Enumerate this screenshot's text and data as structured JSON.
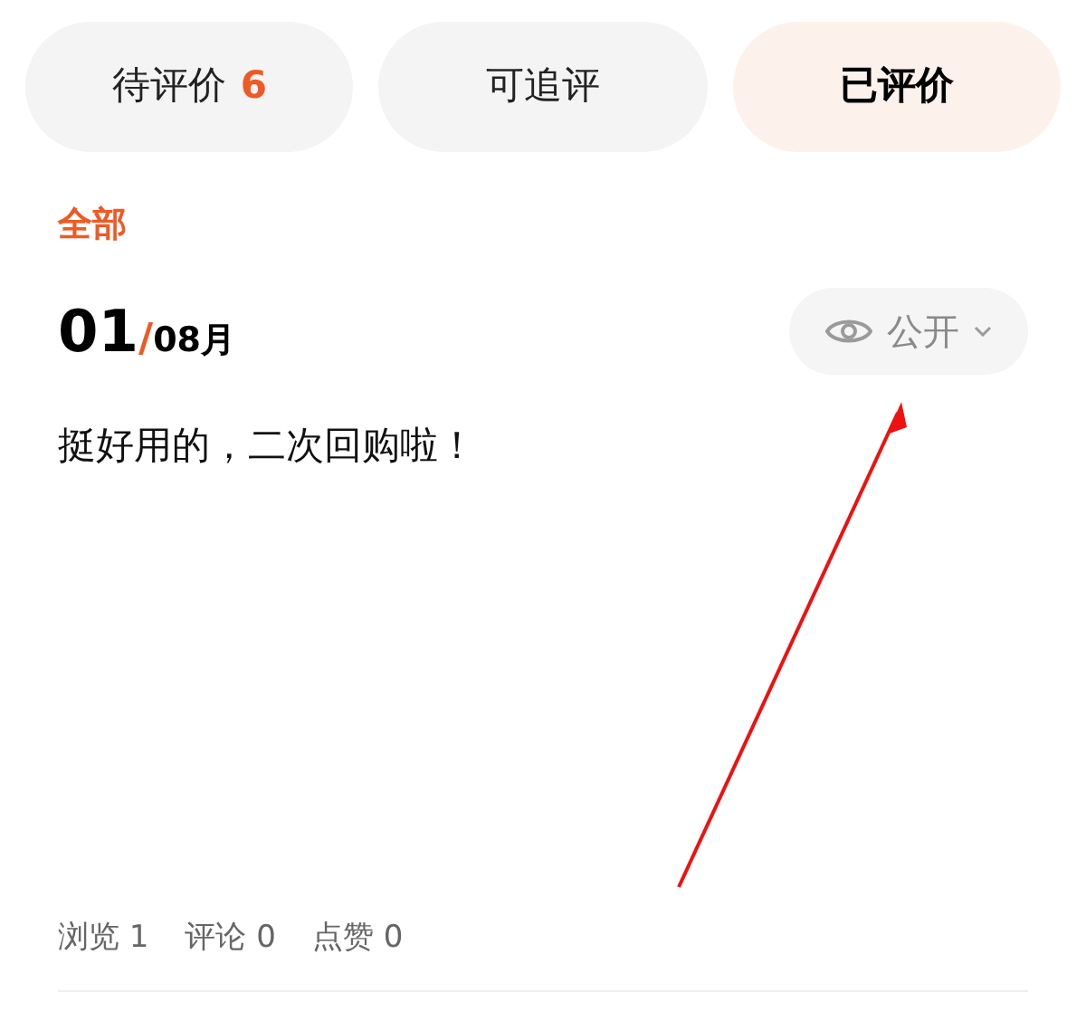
{
  "tabs": [
    {
      "label": "待评价",
      "count": "6",
      "selected": false
    },
    {
      "label": "可追评",
      "selected": false
    },
    {
      "label": "已评价",
      "selected": true
    }
  ],
  "filter": {
    "label": "全部"
  },
  "review": {
    "day": "01",
    "separator": "/",
    "month": "08月",
    "visibility": "公开",
    "text": "挺好用的，二次回购啦！",
    "stats": [
      {
        "label": "浏览",
        "value": "1"
      },
      {
        "label": "评论",
        "value": "0"
      },
      {
        "label": "点赞",
        "value": "0"
      }
    ]
  }
}
